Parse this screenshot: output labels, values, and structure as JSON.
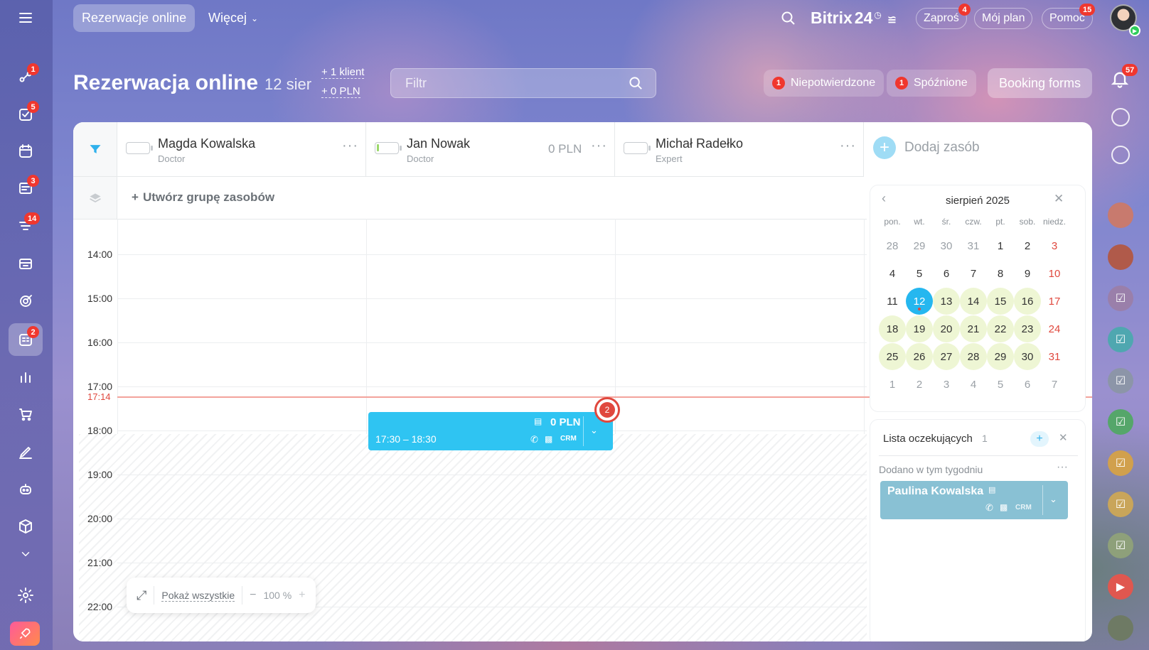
{
  "topbar": {
    "tab_active": "Rezerwacje online",
    "tab_more": "Więcej",
    "brand": "Bitrix",
    "brand_num": "24",
    "invite": "Zaproś",
    "invite_badge": "4",
    "myplan": "Mój plan",
    "help": "Pomoc",
    "help_badge": "15"
  },
  "sidebar_badges": {
    "activity": "1",
    "tasks": "5",
    "feed": "3",
    "crm": "14",
    "booking": "2"
  },
  "header": {
    "title": "Rezerwacja online",
    "date": "12 sier",
    "clients": "+ 1 klient",
    "amount": "+ 0 PLN",
    "filter_placeholder": "Filtr",
    "unconfirmed_count": "1",
    "unconfirmed": "Niepotwierdzone",
    "late_count": "1",
    "late": "Spóźnione",
    "booking_forms": "Booking forms",
    "notif_badge": "57"
  },
  "resources": [
    {
      "name": "Magda Kowalska",
      "role": "Doctor",
      "amount": ""
    },
    {
      "name": "Jan Nowak",
      "role": "Doctor",
      "amount": "0 PLN"
    },
    {
      "name": "Michał Radełko",
      "role": "Expert",
      "amount": ""
    }
  ],
  "add_resource": "Dodaj zasób",
  "create_group": "Utwórz grupę zasobów",
  "hours": [
    "14:00",
    "15:00",
    "16:00",
    "17:00",
    "18:00",
    "19:00",
    "20:00",
    "21:00",
    "22:00"
  ],
  "now_time": "17:14",
  "booking": {
    "time": "17:30 – 18:30",
    "amount": "0 PLN",
    "crm": "CRM",
    "counter": "2"
  },
  "calendar": {
    "month": "sierpień 2025",
    "weekdays": [
      "pon.",
      "wt.",
      "śr.",
      "czw.",
      "pt.",
      "sob.",
      "niedz."
    ],
    "weeks": [
      [
        "28",
        "29",
        "30",
        "31",
        "1",
        "2",
        "3"
      ],
      [
        "4",
        "5",
        "6",
        "7",
        "8",
        "9",
        "10"
      ],
      [
        "11",
        "12",
        "13",
        "14",
        "15",
        "16",
        "17"
      ],
      [
        "18",
        "19",
        "20",
        "21",
        "22",
        "23",
        "24"
      ],
      [
        "25",
        "26",
        "27",
        "28",
        "29",
        "30",
        "31"
      ],
      [
        "1",
        "2",
        "3",
        "4",
        "5",
        "6",
        "7"
      ]
    ]
  },
  "waitlist": {
    "title": "Lista oczekujących",
    "count": "1",
    "section": "Dodano w tym tygodniu",
    "client": "Paulina Kowalska",
    "crm": "CRM"
  },
  "footer": {
    "show_all": "Pokaż wszystkie",
    "zoom": "100 %"
  }
}
